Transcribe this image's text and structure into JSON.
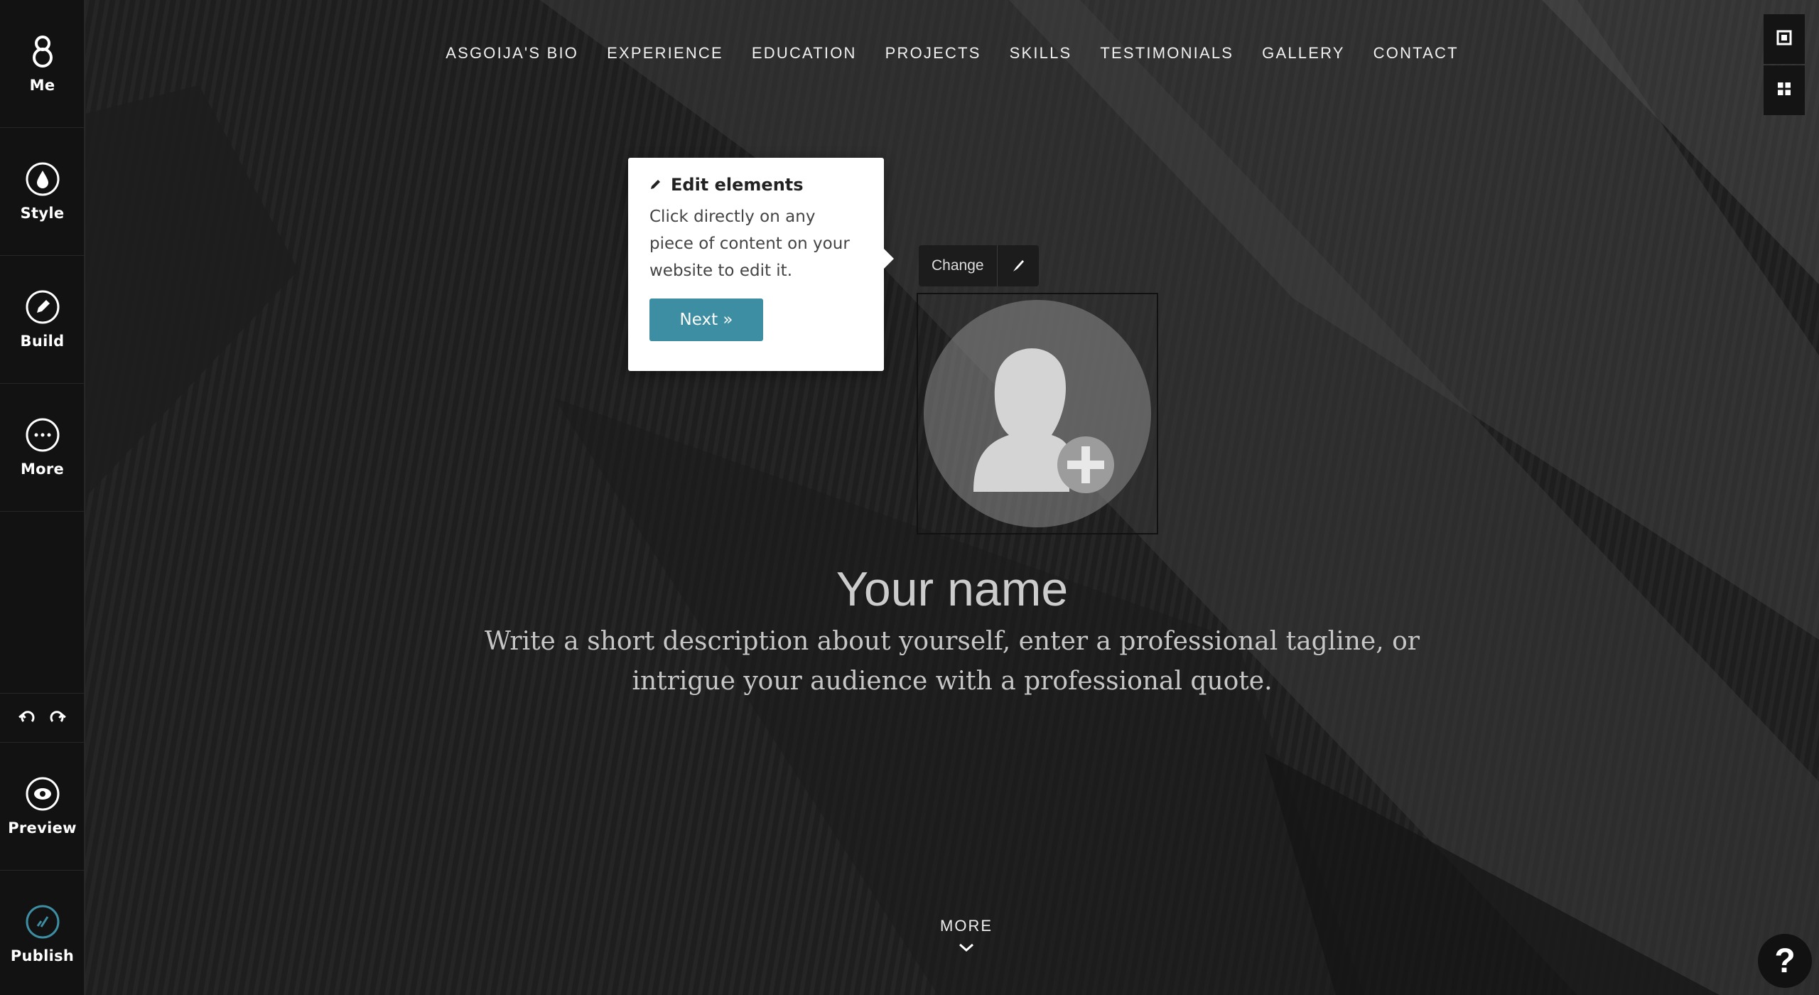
{
  "sidebar": {
    "items": [
      {
        "label": "Me",
        "icon": "lock-icon"
      },
      {
        "label": "Style",
        "icon": "drop-icon"
      },
      {
        "label": "Build",
        "icon": "pencil-icon"
      },
      {
        "label": "More",
        "icon": "ellipsis-icon"
      },
      {
        "label": "Preview",
        "icon": "eye-icon"
      },
      {
        "label": "Publish",
        "icon": "check-icon"
      }
    ],
    "accent": "#3d8ea3"
  },
  "nav": {
    "items": [
      "ASGOIJA'S BIO",
      "EXPERIENCE",
      "EDUCATION",
      "PROJECTS",
      "SKILLS",
      "TESTIMONIALS",
      "GALLERY",
      "CONTACT"
    ]
  },
  "tooltip": {
    "title": "Edit elements",
    "body": "Click directly on any piece of content on your website to edit it.",
    "next_label": "Next »"
  },
  "avatar": {
    "change_label": "Change"
  },
  "hero": {
    "name": "Your name",
    "description": "Write a short description about yourself, enter a professional tagline, or intrigue your audience with a professional quote.",
    "more_label": "MORE"
  },
  "help": {
    "label": "?"
  }
}
